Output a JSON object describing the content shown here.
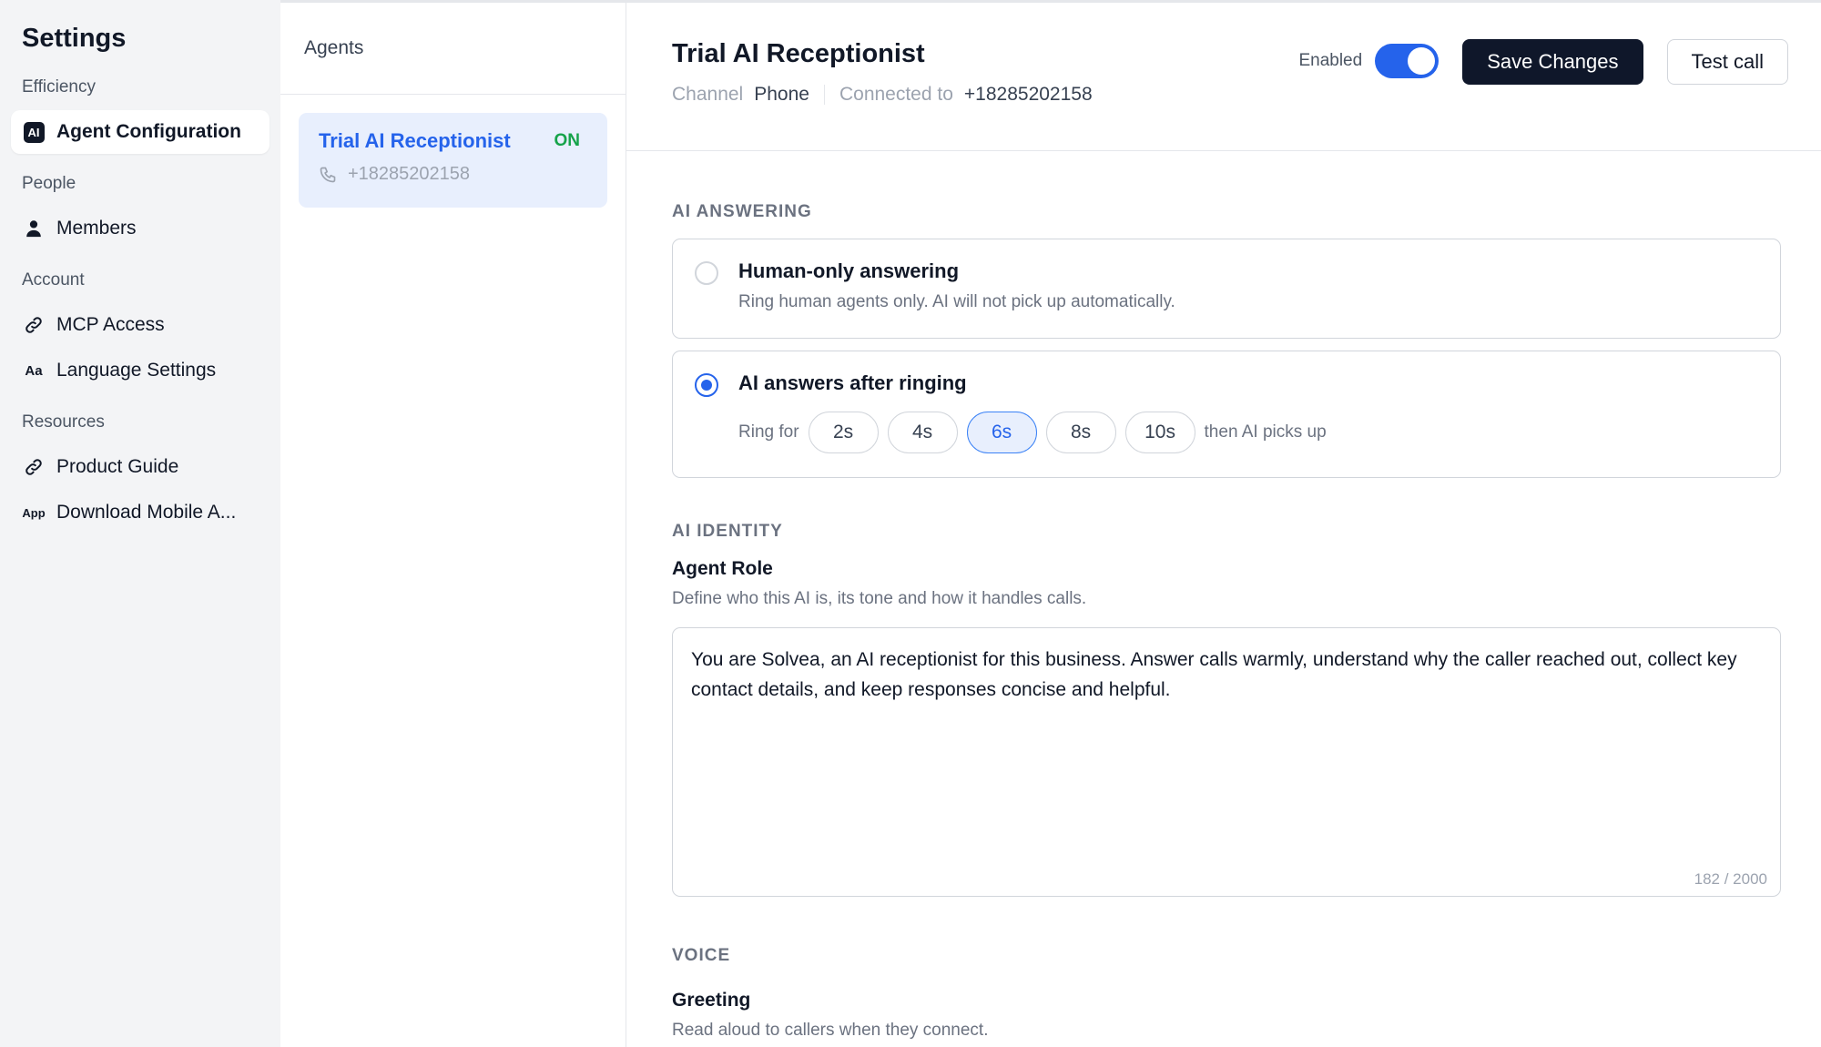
{
  "sidebar": {
    "title": "Settings",
    "sections": {
      "efficiency": {
        "label": "Efficiency",
        "items": [
          {
            "label": "Agent Configuration",
            "icon": "ai-icon",
            "icon_text": "AI"
          }
        ]
      },
      "people": {
        "label": "People",
        "items": [
          {
            "label": "Members",
            "icon": "person-icon"
          }
        ]
      },
      "account": {
        "label": "Account",
        "items": [
          {
            "label": "MCP Access",
            "icon": "link-icon"
          },
          {
            "label": "Language Settings",
            "icon": "language-icon",
            "icon_text": "Aa"
          }
        ]
      },
      "resources": {
        "label": "Resources",
        "items": [
          {
            "label": "Product Guide",
            "icon": "link-icon"
          },
          {
            "label": "Download Mobile A...",
            "icon": "app-icon",
            "icon_text": "App"
          }
        ]
      }
    }
  },
  "agents_panel": {
    "header": "Agents",
    "agents": [
      {
        "name": "Trial AI Receptionist",
        "status": "ON",
        "phone": "+18285202158"
      }
    ]
  },
  "main": {
    "title": "Trial AI Receptionist",
    "channel_label": "Channel",
    "channel_value": "Phone",
    "connected_label": "Connected to",
    "connected_value": "+18285202158",
    "enabled_label": "Enabled",
    "enabled": true,
    "save_label": "Save Changes",
    "test_label": "Test call",
    "ai_answering": {
      "section_title": "AI ANSWERING",
      "human_only": {
        "title": "Human-only answering",
        "description": "Ring human agents only. AI will not pick up automatically.",
        "selected": false
      },
      "after_ringing": {
        "title": "AI answers after ringing",
        "ring_for_label": "Ring for",
        "options": [
          "2s",
          "4s",
          "6s",
          "8s",
          "10s"
        ],
        "selected_option": "6s",
        "suffix": "then AI picks up",
        "selected": true
      }
    },
    "ai_identity": {
      "section_title": "AI IDENTITY",
      "field_label": "Agent Role",
      "field_help": "Define who this AI is, its tone and how it handles calls.",
      "value": "You are Solvea, an AI receptionist for this business. Answer calls warmly, understand why the caller reached out, collect key contact details, and keep responses concise and helpful.",
      "char_count": "182 / 2000"
    },
    "voice": {
      "section_title": "VOICE",
      "field_label": "Greeting",
      "field_help": "Read aloud to callers when they connect."
    }
  },
  "colors": {
    "accent": "#2563eb",
    "on_status": "#16a34a",
    "primary_button": "#0f172a"
  }
}
